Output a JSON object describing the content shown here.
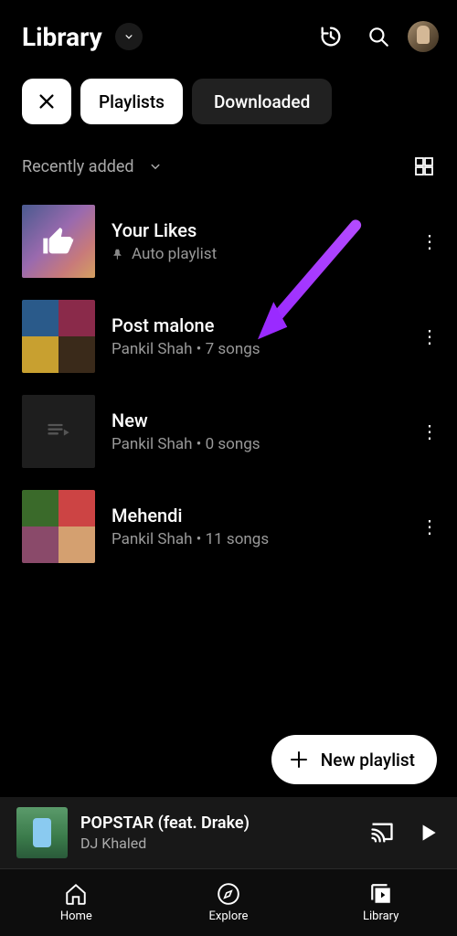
{
  "header": {
    "title": "Library"
  },
  "chips": {
    "playlists": "Playlists",
    "downloaded": "Downloaded"
  },
  "sort": {
    "label": "Recently added"
  },
  "playlists": [
    {
      "title": "Your Likes",
      "subtitle": "Auto playlist",
      "pinned": true
    },
    {
      "title": "Post malone",
      "subtitle": "Pankil Shah • 7 songs"
    },
    {
      "title": "New",
      "subtitle": "Pankil Shah • 0 songs"
    },
    {
      "title": "Mehendi",
      "subtitle": "Pankil Shah • 11 songs"
    }
  ],
  "fab": {
    "label": "New playlist"
  },
  "nowPlaying": {
    "title": "POPSTAR (feat. Drake)",
    "artist": "DJ Khaled"
  },
  "nav": {
    "home": "Home",
    "explore": "Explore",
    "library": "Library"
  }
}
